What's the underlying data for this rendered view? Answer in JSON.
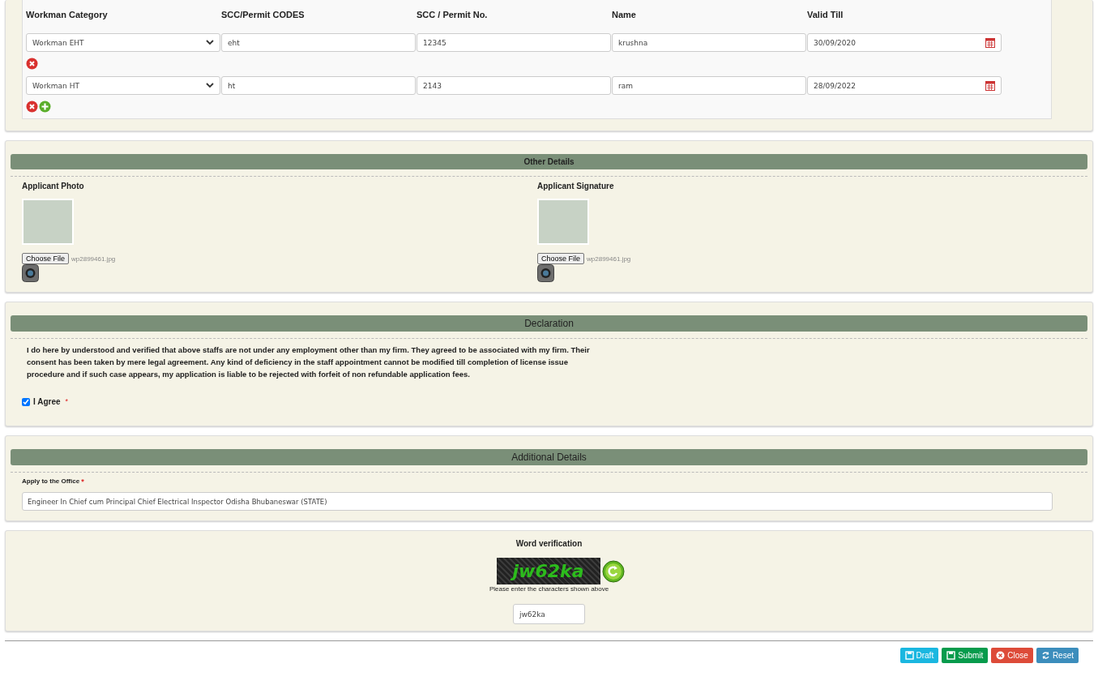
{
  "staff_table": {
    "columns": [
      "Workman Category",
      "SCC/Permit CODES",
      "SCC / Permit No.",
      "Name",
      "Valid Till"
    ],
    "rows": [
      {
        "category": "Workman EHT",
        "code": "eht",
        "permit_no": "12345",
        "name": "krushna",
        "valid_till": "30/09/2020",
        "removable": true,
        "addable": false
      },
      {
        "category": "Workman HT",
        "code": "ht",
        "permit_no": "2143",
        "name": "ram",
        "valid_till": "28/09/2022",
        "removable": true,
        "addable": true
      }
    ]
  },
  "other_details": {
    "title": "Other Details",
    "uploads": [
      {
        "label": "Applicant Photo",
        "button": "Choose File",
        "file": "wp2899461.jpg"
      },
      {
        "label": "Applicant Signature",
        "button": "Choose File",
        "file": "wp2899461.jpg"
      }
    ]
  },
  "declaration": {
    "title": "Declaration",
    "text": "I do here by understood and verified that above staffs are not under any employment other than my firm. They agreed to be associated with my firm. Their consent has been taken by mere legal agreement. Any kind of deficiency in the staff appointment cannot be modified till completion of license issue procedure and if such case appears, my application is liable to be rejected with forfeit of non refundable application fees.",
    "agree": {
      "label": "I Agree",
      "required_mark": "*",
      "checked": true
    }
  },
  "additional_details": {
    "title": "Additional Details",
    "office_label": "Apply to the Office",
    "required_mark": "*",
    "office_value": "Engineer In Chief cum Principal Chief Electrical Inspector Odisha Bhubaneswar (STATE)"
  },
  "word_verification": {
    "title": "Word verification",
    "captcha": "jw62ka",
    "hint": "Please enter the characters shown above",
    "value": "jw62ka"
  },
  "buttons": [
    {
      "label": "Draft",
      "kind": "draft"
    },
    {
      "label": "Submit",
      "kind": "submit"
    },
    {
      "label": "Close",
      "kind": "close"
    },
    {
      "label": "Reset",
      "kind": "reset"
    }
  ]
}
